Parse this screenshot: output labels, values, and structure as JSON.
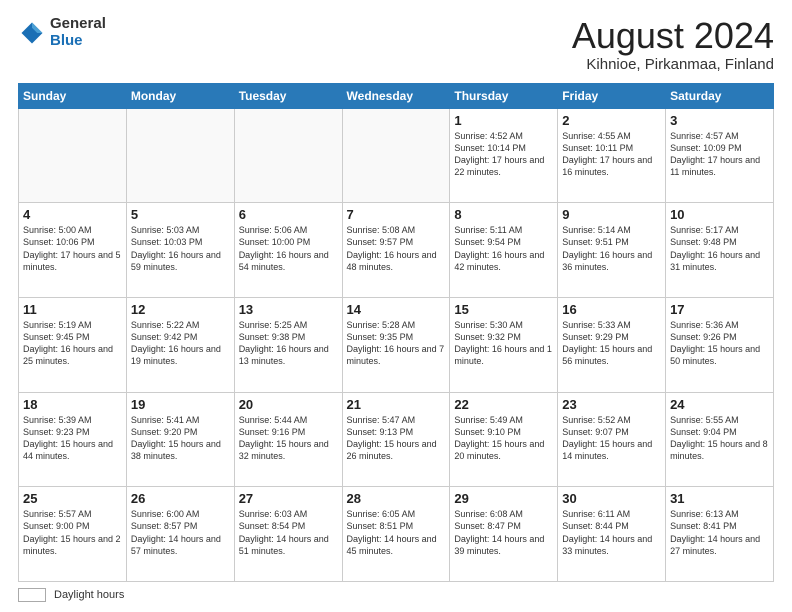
{
  "logo": {
    "general": "General",
    "blue": "Blue"
  },
  "header": {
    "title": "August 2024",
    "subtitle": "Kihnioe, Pirkanmaa, Finland"
  },
  "weekdays": [
    "Sunday",
    "Monday",
    "Tuesday",
    "Wednesday",
    "Thursday",
    "Friday",
    "Saturday"
  ],
  "footer": {
    "label": "Daylight hours"
  },
  "weeks": [
    [
      {
        "day": "",
        "info": ""
      },
      {
        "day": "",
        "info": ""
      },
      {
        "day": "",
        "info": ""
      },
      {
        "day": "",
        "info": ""
      },
      {
        "day": "1",
        "info": "Sunrise: 4:52 AM\nSunset: 10:14 PM\nDaylight: 17 hours\nand 22 minutes."
      },
      {
        "day": "2",
        "info": "Sunrise: 4:55 AM\nSunset: 10:11 PM\nDaylight: 17 hours\nand 16 minutes."
      },
      {
        "day": "3",
        "info": "Sunrise: 4:57 AM\nSunset: 10:09 PM\nDaylight: 17 hours\nand 11 minutes."
      }
    ],
    [
      {
        "day": "4",
        "info": "Sunrise: 5:00 AM\nSunset: 10:06 PM\nDaylight: 17 hours\nand 5 minutes."
      },
      {
        "day": "5",
        "info": "Sunrise: 5:03 AM\nSunset: 10:03 PM\nDaylight: 16 hours\nand 59 minutes."
      },
      {
        "day": "6",
        "info": "Sunrise: 5:06 AM\nSunset: 10:00 PM\nDaylight: 16 hours\nand 54 minutes."
      },
      {
        "day": "7",
        "info": "Sunrise: 5:08 AM\nSunset: 9:57 PM\nDaylight: 16 hours\nand 48 minutes."
      },
      {
        "day": "8",
        "info": "Sunrise: 5:11 AM\nSunset: 9:54 PM\nDaylight: 16 hours\nand 42 minutes."
      },
      {
        "day": "9",
        "info": "Sunrise: 5:14 AM\nSunset: 9:51 PM\nDaylight: 16 hours\nand 36 minutes."
      },
      {
        "day": "10",
        "info": "Sunrise: 5:17 AM\nSunset: 9:48 PM\nDaylight: 16 hours\nand 31 minutes."
      }
    ],
    [
      {
        "day": "11",
        "info": "Sunrise: 5:19 AM\nSunset: 9:45 PM\nDaylight: 16 hours\nand 25 minutes."
      },
      {
        "day": "12",
        "info": "Sunrise: 5:22 AM\nSunset: 9:42 PM\nDaylight: 16 hours\nand 19 minutes."
      },
      {
        "day": "13",
        "info": "Sunrise: 5:25 AM\nSunset: 9:38 PM\nDaylight: 16 hours\nand 13 minutes."
      },
      {
        "day": "14",
        "info": "Sunrise: 5:28 AM\nSunset: 9:35 PM\nDaylight: 16 hours\nand 7 minutes."
      },
      {
        "day": "15",
        "info": "Sunrise: 5:30 AM\nSunset: 9:32 PM\nDaylight: 16 hours\nand 1 minute."
      },
      {
        "day": "16",
        "info": "Sunrise: 5:33 AM\nSunset: 9:29 PM\nDaylight: 15 hours\nand 56 minutes."
      },
      {
        "day": "17",
        "info": "Sunrise: 5:36 AM\nSunset: 9:26 PM\nDaylight: 15 hours\nand 50 minutes."
      }
    ],
    [
      {
        "day": "18",
        "info": "Sunrise: 5:39 AM\nSunset: 9:23 PM\nDaylight: 15 hours\nand 44 minutes."
      },
      {
        "day": "19",
        "info": "Sunrise: 5:41 AM\nSunset: 9:20 PM\nDaylight: 15 hours\nand 38 minutes."
      },
      {
        "day": "20",
        "info": "Sunrise: 5:44 AM\nSunset: 9:16 PM\nDaylight: 15 hours\nand 32 minutes."
      },
      {
        "day": "21",
        "info": "Sunrise: 5:47 AM\nSunset: 9:13 PM\nDaylight: 15 hours\nand 26 minutes."
      },
      {
        "day": "22",
        "info": "Sunrise: 5:49 AM\nSunset: 9:10 PM\nDaylight: 15 hours\nand 20 minutes."
      },
      {
        "day": "23",
        "info": "Sunrise: 5:52 AM\nSunset: 9:07 PM\nDaylight: 15 hours\nand 14 minutes."
      },
      {
        "day": "24",
        "info": "Sunrise: 5:55 AM\nSunset: 9:04 PM\nDaylight: 15 hours\nand 8 minutes."
      }
    ],
    [
      {
        "day": "25",
        "info": "Sunrise: 5:57 AM\nSunset: 9:00 PM\nDaylight: 15 hours\nand 2 minutes."
      },
      {
        "day": "26",
        "info": "Sunrise: 6:00 AM\nSunset: 8:57 PM\nDaylight: 14 hours\nand 57 minutes."
      },
      {
        "day": "27",
        "info": "Sunrise: 6:03 AM\nSunset: 8:54 PM\nDaylight: 14 hours\nand 51 minutes."
      },
      {
        "day": "28",
        "info": "Sunrise: 6:05 AM\nSunset: 8:51 PM\nDaylight: 14 hours\nand 45 minutes."
      },
      {
        "day": "29",
        "info": "Sunrise: 6:08 AM\nSunset: 8:47 PM\nDaylight: 14 hours\nand 39 minutes."
      },
      {
        "day": "30",
        "info": "Sunrise: 6:11 AM\nSunset: 8:44 PM\nDaylight: 14 hours\nand 33 minutes."
      },
      {
        "day": "31",
        "info": "Sunrise: 6:13 AM\nSunset: 8:41 PM\nDaylight: 14 hours\nand 27 minutes."
      }
    ]
  ]
}
